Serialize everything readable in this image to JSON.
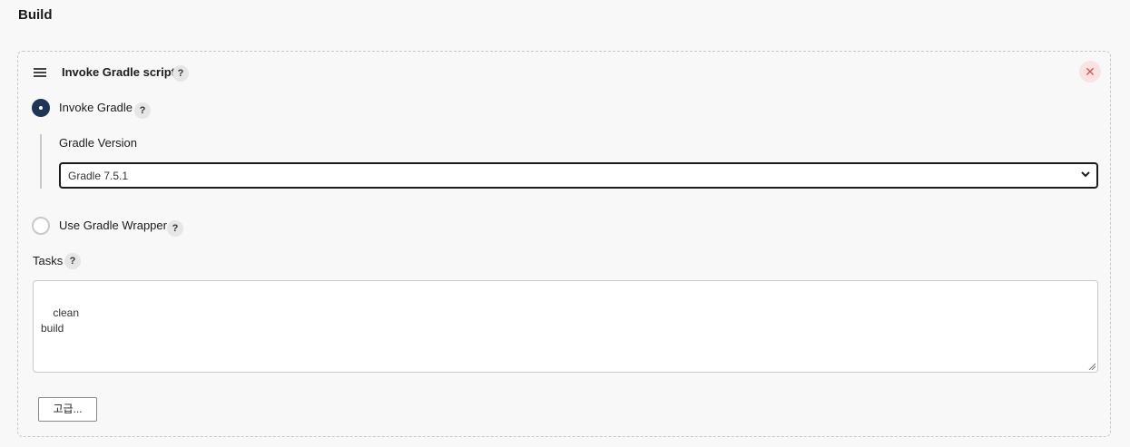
{
  "section": {
    "title": "Build"
  },
  "step": {
    "title": "Invoke Gradle script",
    "help": "?",
    "close": "✕",
    "invoke_gradle": {
      "label": "Invoke Gradle",
      "help": "?",
      "selected": true
    },
    "gradle_version": {
      "label": "Gradle Version",
      "selected": "Gradle 7.5.1"
    },
    "use_wrapper": {
      "label": "Use Gradle Wrapper",
      "help": "?",
      "selected": false
    },
    "tasks": {
      "label": "Tasks",
      "help": "?",
      "value": "clean\nbuild"
    },
    "advanced_button": "고급..."
  },
  "colors": {
    "radio_checked": "#1d3557",
    "close_bg": "#fbe3e3",
    "close_fg": "#d9534f"
  },
  "icons": {
    "drag": "drag-handle-icon",
    "close": "close-icon",
    "help": "help-icon",
    "dropdown": "chevron-down-icon"
  }
}
